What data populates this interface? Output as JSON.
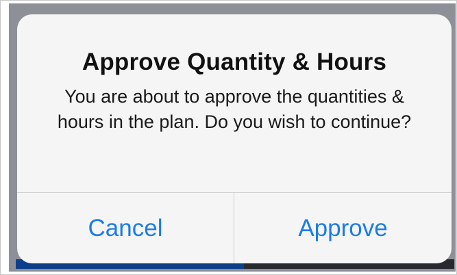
{
  "dialog": {
    "title": "Approve Quantity & Hours",
    "message": "You are about to approve the quantities & hours in the plan. Do you wish to continue?",
    "cancel_label": "Cancel",
    "approve_label": "Approve"
  },
  "colors": {
    "action_tint": "#1b7ce8",
    "dialog_background": "#f5f5f5",
    "backdrop": "#8e9097"
  }
}
